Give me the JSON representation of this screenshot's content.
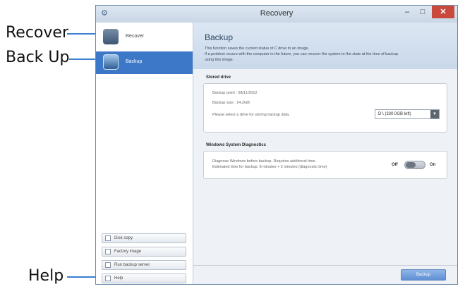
{
  "callouts": {
    "recover": "Recover",
    "backup": "Back Up",
    "help": "Help"
  },
  "window": {
    "title": "Recovery",
    "controls": {
      "minimize": "–",
      "maximize": "□",
      "close": "✕"
    }
  },
  "sidebar": {
    "items": [
      {
        "label": "Recover",
        "icon": "recover-disk-icon"
      },
      {
        "label": "Backup",
        "icon": "backup-disk-icon",
        "selected": true
      }
    ],
    "buttons": [
      {
        "label": "Disk copy",
        "icon": "disk-copy-icon"
      },
      {
        "label": "Factory image",
        "icon": "factory-image-icon"
      },
      {
        "label": "Run backup server",
        "icon": "server-icon"
      },
      {
        "label": "Help",
        "icon": "help-icon"
      }
    ]
  },
  "main": {
    "title": "Backup",
    "description_line1": "This function saves the current status of C drive to an image.",
    "description_line2": "If a problem occurs with the computer in the future, you can recover the system to the state at the time of backup",
    "description_line3": "using this image.",
    "stored_drive": {
      "heading": "Stored drive",
      "backup_point": "Backup point : 08/11/2012",
      "backup_size": "Backup size : 14.2GB",
      "prompt": "Please select a drive for storing backup data.",
      "drive_value": "D:\\ (330.0GB left)"
    },
    "diagnostics": {
      "heading": "Windows System Diagnostics",
      "line1": "Diagnose Windows before backup. Requires additional time.",
      "line2": "Estimated time for backup: 8 minutes + 2 minutes (diagnostic time)",
      "toggle_off": "Off",
      "toggle_on": "On",
      "state": "off"
    },
    "start_button": "Backup"
  },
  "colors": {
    "accent": "#3d78c8",
    "callout_line": "#3a7fd0",
    "close": "#c94a3d"
  }
}
